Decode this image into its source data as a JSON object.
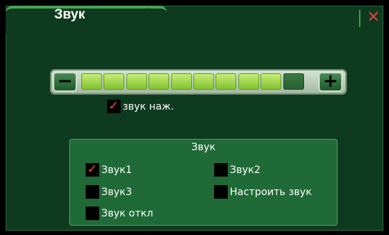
{
  "header": {
    "title": "Звук",
    "close_symbol": "✕"
  },
  "volume": {
    "minus_label": "−",
    "plus_label": "+",
    "segments_total": 10,
    "level": 9,
    "on_color": "#9fd445",
    "off_color": "#2f6a3a"
  },
  "key_sound": {
    "label": "звук наж.",
    "checked": true
  },
  "group": {
    "title": "Звук",
    "options": [
      {
        "label": "Звук1",
        "checked": true
      },
      {
        "label": "Звук2",
        "checked": false
      },
      {
        "label": "Звук3",
        "checked": false
      },
      {
        "label": "Настроить звук",
        "checked": false
      },
      {
        "label": "Звук откл",
        "checked": false
      }
    ]
  },
  "colors": {
    "background": "#0e3a20",
    "panel": "#1f6a36",
    "check": "#ff4545",
    "close": "#e04040"
  }
}
